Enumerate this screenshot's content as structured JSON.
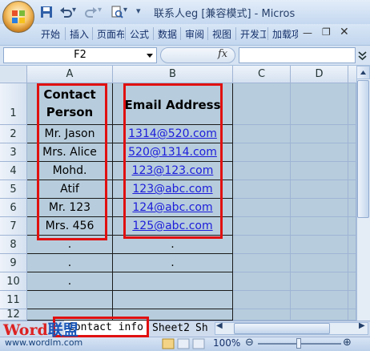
{
  "window": {
    "title": "联系人eg [兼容模式] - Micros"
  },
  "ribbon_tabs": [
    "开始",
    "插入",
    "页面布",
    "公式",
    "数据",
    "审阅",
    "视图",
    "开发工",
    "加载项"
  ],
  "formula_bar": {
    "name_box": "F2",
    "fx_label": "fx",
    "formula": ""
  },
  "columns": [
    "A",
    "B",
    "C",
    "D"
  ],
  "rows": [
    "1",
    "2",
    "3",
    "4",
    "5",
    "6",
    "7",
    "8",
    "9",
    "10",
    "11",
    "12"
  ],
  "sheet": {
    "header_a": "Contact Person",
    "header_b": "Email Address",
    "col_a": [
      "Mr. Jason",
      "Mrs. Alice",
      "Mohd.",
      "Atif",
      "Mr. 123",
      "Mrs. 456",
      ".",
      ".",
      ".",
      "",
      ""
    ],
    "col_b": [
      "1314@520.com",
      "520@1314.com",
      "123@123.com",
      "123@abc.com",
      "124@abc.com",
      "125@abc.com",
      ".",
      ".",
      "",
      "",
      ""
    ]
  },
  "sheet_tabs": [
    "Contact info",
    "Sheet2",
    "Sh"
  ],
  "status": {
    "zoom": "100%"
  },
  "watermark": {
    "logo_a": "Word",
    "logo_b": "联盟",
    "url": "www.wordlm.com"
  },
  "colors": {
    "annotation_red": "#e01010",
    "link_blue": "#1d1dd9"
  }
}
